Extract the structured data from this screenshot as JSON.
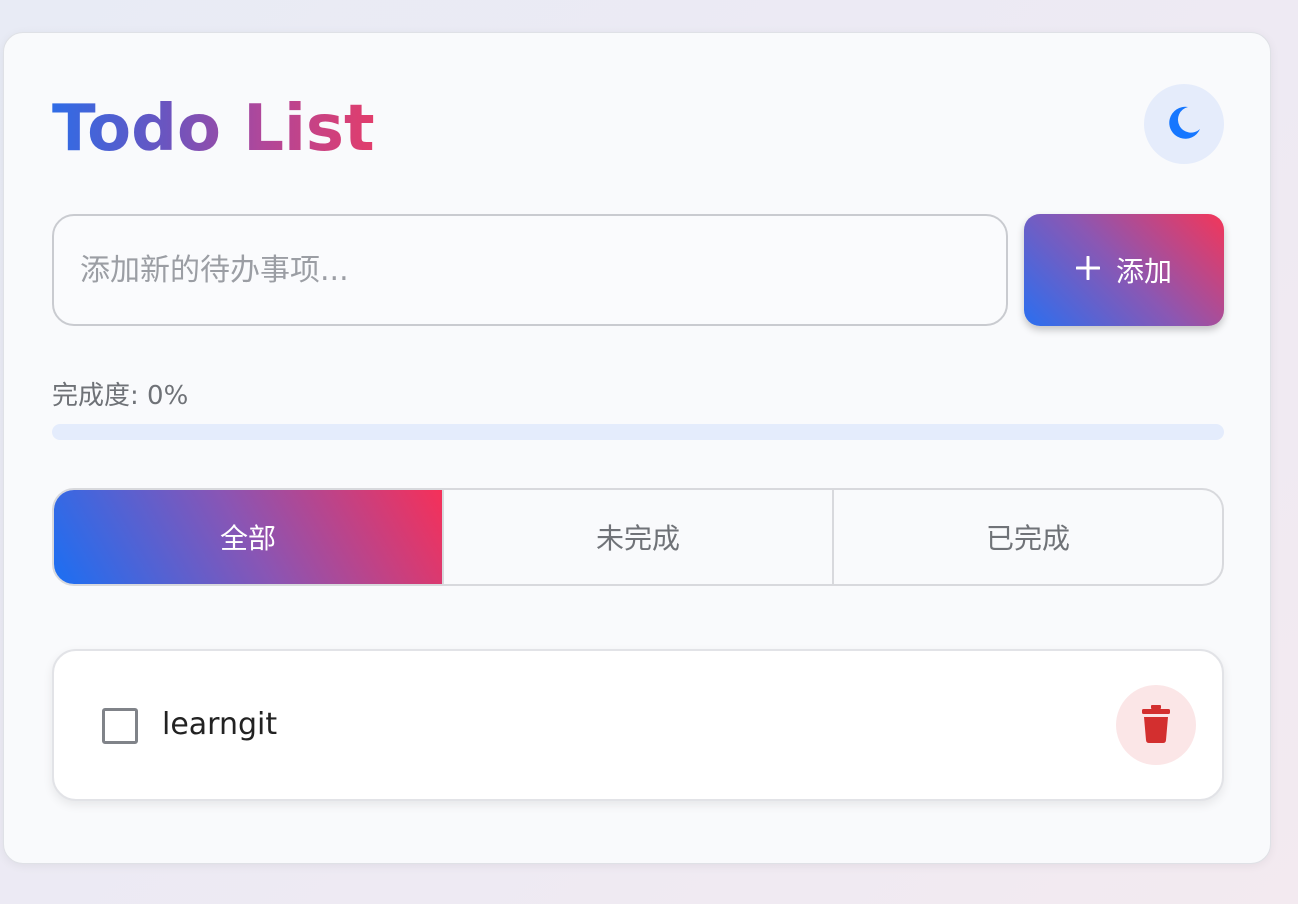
{
  "header": {
    "title": "Todo List",
    "theme_toggle_icon": "moon-icon"
  },
  "add_form": {
    "placeholder": "添加新的待办事项...",
    "add_icon": "plus-icon",
    "add_label": "添加"
  },
  "progress": {
    "label": "完成度: 0%",
    "value": 0
  },
  "filters": [
    {
      "label": "全部",
      "active": true
    },
    {
      "label": "未完成",
      "active": false
    },
    {
      "label": "已完成",
      "active": false
    }
  ],
  "todos": [
    {
      "text": "learngit",
      "completed": false,
      "delete_icon": "trash-icon"
    }
  ],
  "colors": {
    "accent_blue": "#1b6ff3",
    "accent_pink": "#f53059",
    "delete_red": "#d32f2f"
  }
}
